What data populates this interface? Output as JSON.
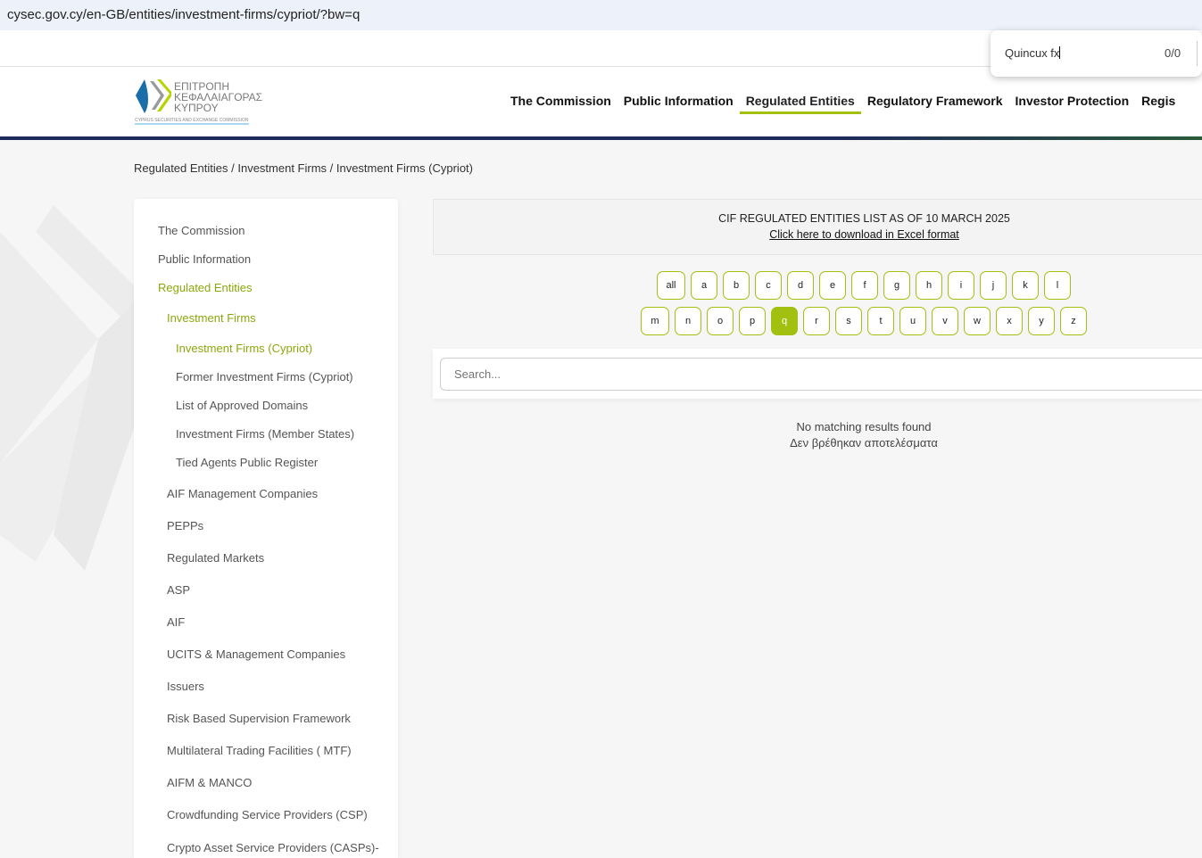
{
  "browser": {
    "url": "cysec.gov.cy/en-GB/entities/investment-firms/cypriot/?bw=q",
    "find_query": "Quincux fx",
    "find_count": "0/0"
  },
  "logo": {
    "greek_lines": [
      "ΕΠΙΤΡΟΠΗ",
      "ΚΕΦΑΛΑΙΑΓΟΡΑΣ",
      "ΚΥΠΡΟΥ"
    ],
    "english": "CYPRUS SECURITIES AND EXCHANGE COMMISSION"
  },
  "nav": [
    "The Commission",
    "Public Information",
    "Regulated Entities",
    "Regulatory Framework",
    "Investor Protection",
    "Regis"
  ],
  "breadcrumb": "Regulated Entities / Investment Firms / Investment Firms (Cypriot)",
  "sidebar": [
    "The Commission",
    "Public Information",
    "Regulated Entities",
    "Investment Firms",
    "Investment Firms (Cypriot)",
    "Former Investment Firms (Cypriot)",
    "List of Approved Domains",
    "Investment Firms (Member States)",
    "Tied Agents Public Register",
    "AIF Management Companies",
    "PEPPs",
    "Regulated Markets",
    "ASP",
    "AIF",
    "UCITS & Management Companies",
    "Issuers",
    "Risk Based Supervision Framework",
    "Multilateral Trading Facilities ( MTF)",
    "AIFM & MANCO",
    "Crowdfunding Service Providers (CSP)",
    "Crypto Asset Service Providers (CASPs)-"
  ],
  "notice": {
    "title": "CIF REGULATED ENTITIES LIST AS OF 10 MARCH 2025",
    "link": "Click here to download in Excel format"
  },
  "letters_row1": [
    "all",
    "a",
    "b",
    "c",
    "d",
    "e",
    "f",
    "g",
    "h",
    "i",
    "j",
    "k",
    "l"
  ],
  "letters_row2": [
    "m",
    "n",
    "o",
    "p",
    "q",
    "r",
    "s",
    "t",
    "u",
    "v",
    "w",
    "x",
    "y",
    "z"
  ],
  "selected_letter": "q",
  "search": {
    "placeholder": "Search..."
  },
  "no_results": {
    "en": "No matching results found",
    "el": "Δεν βρέθηκαν αποτελέσματα"
  },
  "colors": {
    "accent": "#a2c00f",
    "navy": "#1e2b5a"
  }
}
